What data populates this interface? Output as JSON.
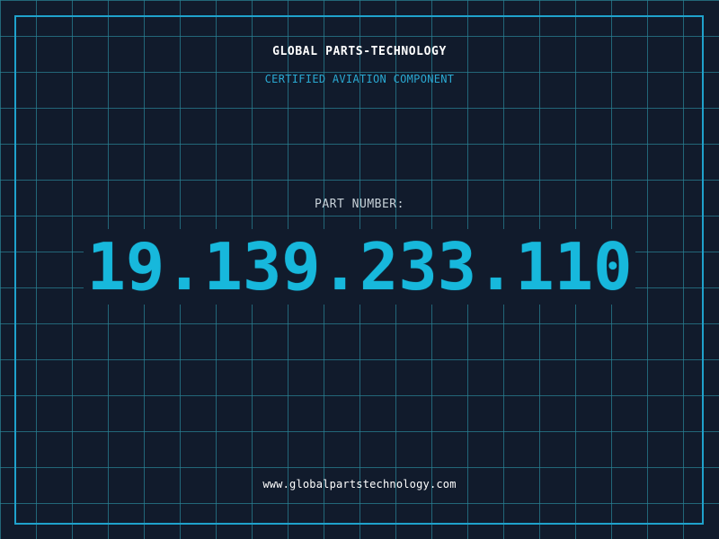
{
  "header": {
    "company": "GLOBAL PARTS-TECHNOLOGY",
    "subtitle": "CERTIFIED AVIATION COMPONENT"
  },
  "part": {
    "label": "PART NUMBER:",
    "number": "19.139.233.110"
  },
  "footer": {
    "website": "www.globalpartstechnology.com"
  },
  "colors": {
    "background": "#111b2c",
    "grid": "#298296",
    "frame": "#1fa2cc",
    "accent": "#17b8dc",
    "text": "#ffffff",
    "muted": "#c7d1d8"
  }
}
